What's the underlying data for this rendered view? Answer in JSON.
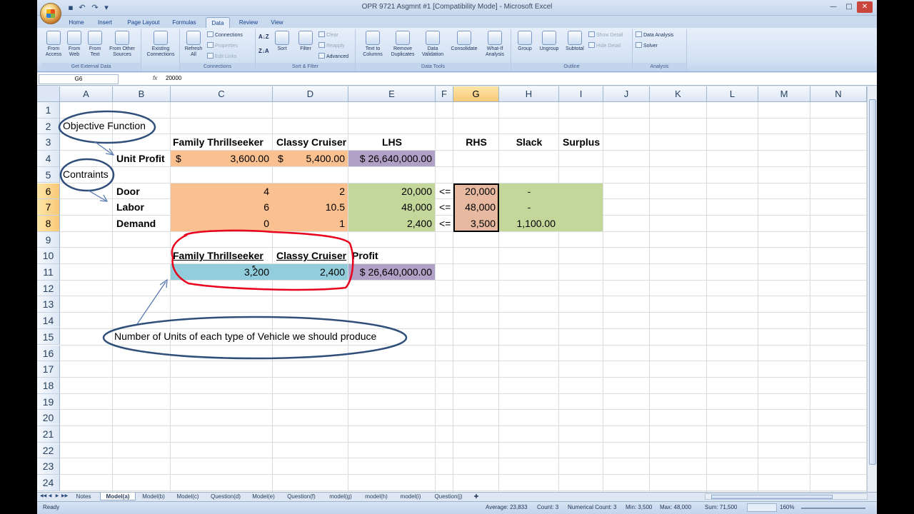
{
  "window": {
    "title": "OPR 9721 Asgmnt #1 [Compatibility Mode] - Microsoft Excel",
    "controls": [
      "—",
      "□",
      "✕"
    ]
  },
  "ribbon_tabs": [
    {
      "label": "Home",
      "active": false
    },
    {
      "label": "Insert",
      "active": false
    },
    {
      "label": "Page Layout",
      "active": false
    },
    {
      "label": "Formulas",
      "active": false
    },
    {
      "label": "Data",
      "active": true
    },
    {
      "label": "Review",
      "active": false
    },
    {
      "label": "View",
      "active": false
    }
  ],
  "ribbon": {
    "get_external_data": {
      "label": "Get External Data",
      "buttons": [
        "From Access",
        "From Web",
        "From Text",
        "From Other Sources"
      ]
    },
    "existing_connections": "Existing Connections",
    "connections": {
      "label": "Connections",
      "refresh": "Refresh All",
      "items": [
        "Connections",
        "Properties",
        "Edit Links"
      ]
    },
    "sort_filter": {
      "label": "Sort & Filter",
      "sort": "Sort",
      "filter": "Filter",
      "items": [
        "Clear",
        "Reapply",
        "Advanced"
      ]
    },
    "data_tools": {
      "label": "Data Tools",
      "buttons": [
        "Text to Columns",
        "Remove Duplicates",
        "Data Validation",
        "Consolidate",
        "What-If Analysis"
      ]
    },
    "outline": {
      "label": "Outline",
      "buttons": [
        "Group",
        "Ungroup",
        "Subtotal"
      ],
      "items": [
        "Show Detail",
        "Hide Detail"
      ]
    },
    "analysis": {
      "label": "Analysis",
      "items": [
        "Data Analysis",
        "Solver"
      ]
    }
  },
  "formula_bar": {
    "name_box": "G6",
    "fx": "fx",
    "value": "20000"
  },
  "columns": [
    "A",
    "B",
    "C",
    "D",
    "E",
    "F",
    "G",
    "H",
    "I",
    "J",
    "K",
    "L",
    "M",
    "N"
  ],
  "rows": [
    "1",
    "2",
    "3",
    "4",
    "5",
    "6",
    "7",
    "8",
    "9",
    "10",
    "11",
    "12",
    "13",
    "14",
    "15",
    "16",
    "17",
    "18",
    "19",
    "20",
    "21",
    "22",
    "23",
    "24"
  ],
  "cells": {
    "C3": "Family Thrillseeker",
    "D3": "Classy Cruiser",
    "E3": "LHS",
    "G3": "RHS",
    "H3": "Slack",
    "I3": "Surplus",
    "B4": "Unit Profit",
    "C4_sym": "$",
    "C4": "3,600.00",
    "D4_sym": "$",
    "D4": "5,400.00",
    "E4": "$ 26,640,000.00",
    "B6": "Door",
    "C6": "4",
    "D6": "2",
    "E6": "20,000",
    "F6": "<=",
    "G6": "20,000",
    "H6": "-",
    "B7": "Labor",
    "C7": "6",
    "D7": "10.5",
    "E7": "48,000",
    "F7": "<=",
    "G7": "48,000",
    "H7": "-",
    "B8": "Demand",
    "C8": "0",
    "D8": "1",
    "E8": "2,400",
    "F8": "<=",
    "G8": "3,500",
    "H8": "1,100.00",
    "C10": "Family Thrillseeker",
    "D10": "Classy Cruiser",
    "E10": "Profit",
    "C11": "3,200",
    "D11": "2,400",
    "E11": "$ 26,640,000.00"
  },
  "annotations": {
    "objective": "Objective Function",
    "constraints": "Contraints",
    "units": "Number of Units of each type of Vehicle we should produce"
  },
  "colors": {
    "orange_fill": "#fac090",
    "purple_fill": "#b2a1c7",
    "green_fill": "#c4d79b",
    "blue_fill": "#92cddc",
    "annotation_ellipse": "#2f4f7a",
    "freehand_red": "#e8001c"
  },
  "sheet_tabs": [
    {
      "label": "Notes",
      "active": false
    },
    {
      "label": "Model(a)",
      "active": true
    },
    {
      "label": "Model(b)",
      "active": false
    },
    {
      "label": "Model(c)",
      "active": false
    },
    {
      "label": "Question(d)",
      "active": false
    },
    {
      "label": "Model(e)",
      "active": false
    },
    {
      "label": "Question(f)",
      "active": false
    },
    {
      "label": "model(g)",
      "active": false
    },
    {
      "label": "model(h)",
      "active": false
    },
    {
      "label": "model(i)",
      "active": false
    },
    {
      "label": "Question(j)",
      "active": false
    }
  ],
  "status": {
    "mode": "Ready",
    "average": "Average: 23,833",
    "count": "Count: 3",
    "numerical_count": "Numerical Count: 3",
    "min": "Min: 3,500",
    "max": "Max: 48,000",
    "sum": "Sum: 71,500",
    "zoom": "160%"
  }
}
